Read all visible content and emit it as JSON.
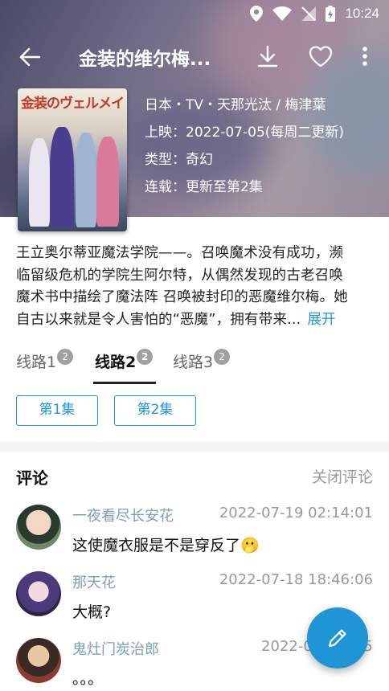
{
  "status_bar": {
    "time": "10:24",
    "icons": [
      "location-icon",
      "wifi-icon",
      "no-signal-icon",
      "battery-charging-icon"
    ]
  },
  "app_bar": {
    "title": "金装的维尔梅...",
    "icons": [
      "back-arrow-icon",
      "download-icon",
      "heart-outline-icon",
      "more-vert-icon"
    ]
  },
  "detail": {
    "poster_title": "金装のヴェルメイユ",
    "meta_line": "日本・TV・天那光汰 / 梅津葉",
    "premiere_label": "上映：",
    "premiere_value": "2022-07-05(每周二更新)",
    "genre_label": "类型：",
    "genre_value": "奇幻",
    "status_label": "连载：",
    "status_value": "更新至第2集"
  },
  "description": {
    "line1": "王立奥尔蒂亚魔法学院——。召唤魔术没有成功，濒",
    "line2": "临留级危机的学院生阿尔特，从偶然发现的古老召唤",
    "line3": "魔术书中描绘了魔法阵 召唤被封印的恶魔维尔梅。她",
    "line4": "自古以来就是令人害怕的“恶魔”，拥有带来...",
    "expand_label": "展开"
  },
  "routes": [
    {
      "label": "线路1",
      "badge": "2",
      "active": false
    },
    {
      "label": "线路2",
      "badge": "2",
      "active": true
    },
    {
      "label": "线路3",
      "badge": "2",
      "active": false
    }
  ],
  "episodes": [
    "第1集",
    "第2集"
  ],
  "comments_section": {
    "title": "评论",
    "close_label": "关闭评论",
    "items": [
      {
        "user": "一夜看尽长安花",
        "time": "2022-07-19 02:14:01",
        "text": "这使魔衣服是不是穿反了🫢"
      },
      {
        "user": "那天花",
        "time": "2022-07-18 18:46:06",
        "text": "大概?"
      },
      {
        "user": "鬼灶门炭治郎",
        "time": "2022-07-16 ...5",
        "text": "。。。"
      }
    ]
  },
  "fab": {
    "icon": "edit-pencil-icon"
  },
  "colors": {
    "accent": "#1f95d6",
    "username": "#7da0b6",
    "muted": "#999999"
  }
}
